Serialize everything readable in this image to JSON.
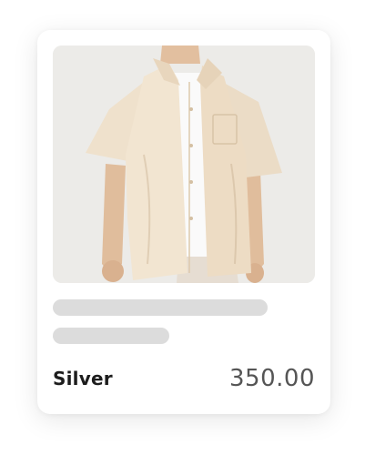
{
  "product": {
    "name": "Silver",
    "price": "350.00",
    "image": "beige-short-sleeve-shirt-photo"
  },
  "colors": {
    "skeleton": "#dcdcdc",
    "shirt": "#eee0cc",
    "background": "#eceae6",
    "title": "#1d1d1d",
    "price": "#555555"
  }
}
